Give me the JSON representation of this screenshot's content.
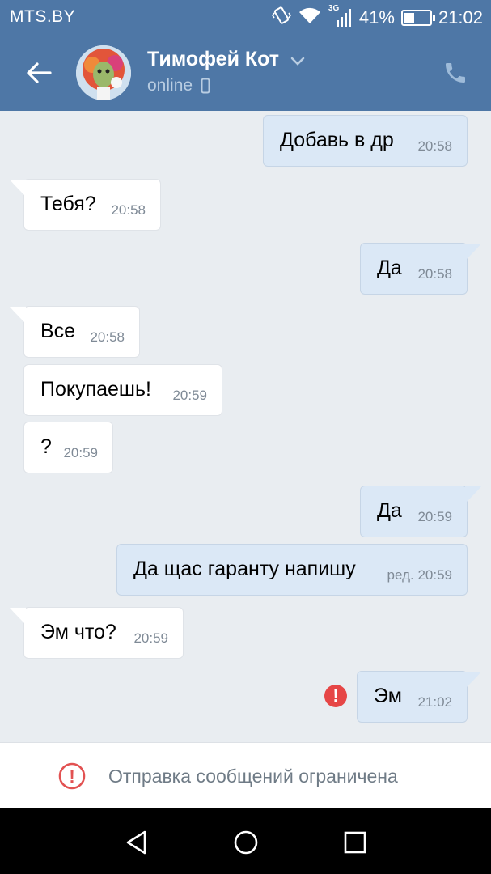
{
  "status_bar": {
    "carrier": "MTS.BY",
    "network": "3G",
    "battery": "41%",
    "battery_level": 0.41,
    "time": "21:02"
  },
  "header": {
    "contact_name": "Тимофей Кот",
    "status": "online",
    "icons": [
      "back-arrow-icon",
      "chevron-down-icon",
      "mobile-device-icon",
      "phone-icon"
    ]
  },
  "messages": [
    {
      "dir": "out",
      "text": "Добавь в др",
      "time": "20:58"
    },
    {
      "dir": "in",
      "text": "Тебя?",
      "time": "20:58"
    },
    {
      "dir": "out",
      "text": "Да",
      "time": "20:58"
    },
    {
      "dir": "in",
      "text": "Все",
      "time": "20:58"
    },
    {
      "dir": "in",
      "text": "Покупаешь!",
      "time": "20:59"
    },
    {
      "dir": "in",
      "text": "?",
      "time": "20:59"
    },
    {
      "dir": "out",
      "text": "Да",
      "time": "20:59"
    },
    {
      "dir": "out",
      "text": "Да щас гаранту напишу",
      "time": "ред. 20:59"
    },
    {
      "dir": "in",
      "text": "Эм что?",
      "time": "20:59"
    },
    {
      "dir": "out",
      "text": "Эм",
      "time": "21:02",
      "error_mark": "!"
    }
  ],
  "footer": {
    "restriction_text": "Отправка сообщений ограничена",
    "error_mark": "!"
  },
  "colors": {
    "header": "#4e77a6",
    "background": "#e9edf1",
    "outgoing_bubble": "#dbe8f6",
    "incoming_bubble": "#ffffff",
    "error": "#e64646"
  }
}
